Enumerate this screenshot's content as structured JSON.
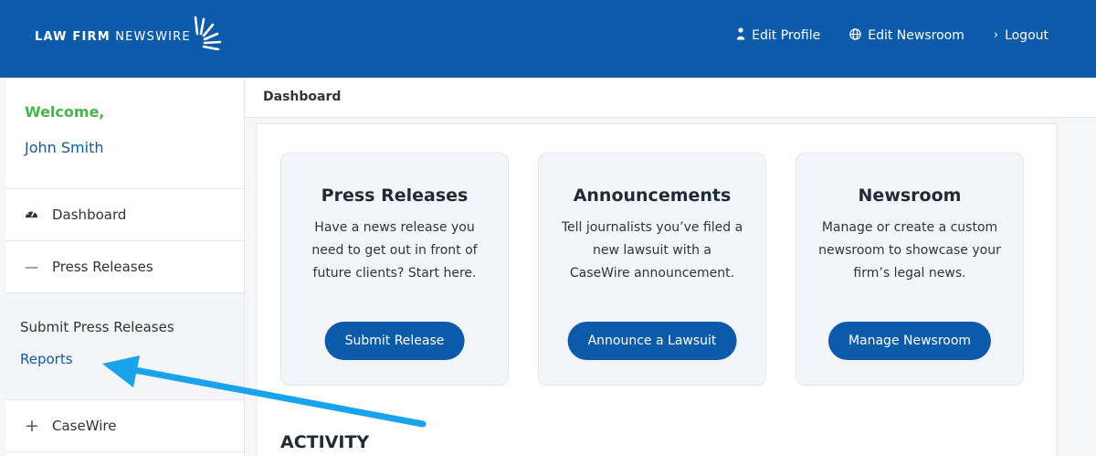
{
  "brand": {
    "bold": "LAW FIRM",
    "light": " NEWSWIRE"
  },
  "topnav": [
    {
      "label": "Edit Profile",
      "icon": "user-icon"
    },
    {
      "label": "Edit Newsroom",
      "icon": "globe-icon"
    },
    {
      "label": "Logout",
      "icon": "chevron-right-icon"
    }
  ],
  "sidebar": {
    "welcome": "Welcome,",
    "name": "John Smith",
    "items": [
      {
        "label": "Dashboard"
      },
      {
        "label": "Press Releases"
      },
      {
        "label": "CaseWire"
      }
    ],
    "submenu": [
      {
        "label": "Submit Press Releases"
      },
      {
        "label": "Reports"
      }
    ]
  },
  "breadcrumb": "Dashboard",
  "cards": [
    {
      "title": "Press Releases",
      "text": "Have a news release you need to get out in front of future clients? Start here.",
      "button": "Submit Release"
    },
    {
      "title": "Announcements",
      "text": "Tell journalists you’ve filed a new lawsuit with a CaseWire announcement.",
      "button": "Announce a Lawsuit"
    },
    {
      "title": "Newsroom",
      "text": "Manage or create a custom newsroom to showcase your firm’s legal news.",
      "button": "Manage Newsroom"
    }
  ],
  "activity_heading": "ACTIVITY",
  "colors": {
    "brand_blue": "#0c5bab",
    "welcome_green": "#47b548",
    "annotation_arrow": "#19a3ec"
  }
}
